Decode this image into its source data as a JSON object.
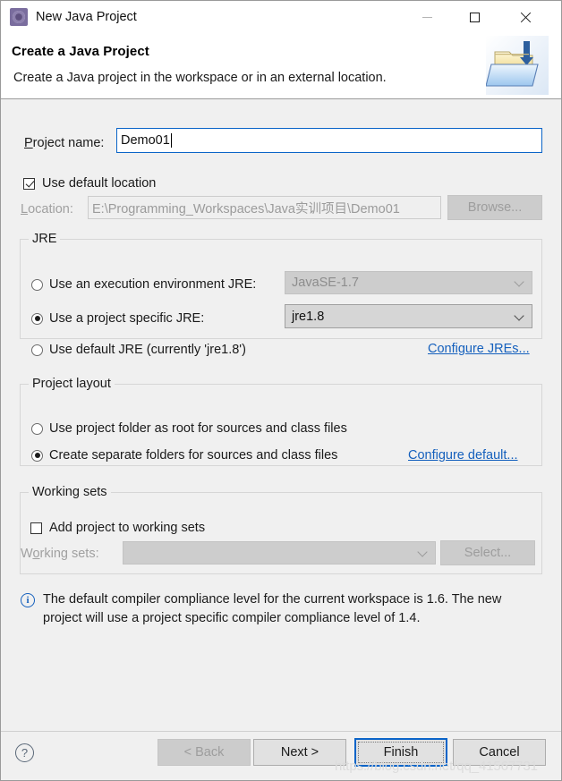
{
  "window": {
    "title": "New Java Project",
    "icon": "eclipse-java-icon",
    "minimize_label": "—",
    "maximize_label": "□",
    "close_label": "✕"
  },
  "header": {
    "title": "Create a Java Project",
    "description": "Create a Java project in the workspace or in an external location.",
    "banner_icon": "java-project-folder-icon"
  },
  "project_name": {
    "label": "Project name:",
    "value": "Demo01",
    "placeholder": ""
  },
  "location": {
    "use_default_label": "Use default location",
    "use_default_checked": true,
    "label": "Location:",
    "value": "E:\\Programming_Workspaces\\Java实训项目\\Demo01",
    "browse_label": "Browse...",
    "browse_enabled": false
  },
  "jre": {
    "group_title": "JRE",
    "options": [
      {
        "label": "Use an execution environment JRE:",
        "selected": false,
        "combo_value": "JavaSE-1.7",
        "combo_enabled": false
      },
      {
        "label": "Use a project specific JRE:",
        "selected": true,
        "combo_value": "jre1.8",
        "combo_enabled": true
      },
      {
        "label": "Use default JRE (currently 'jre1.8')",
        "selected": false
      }
    ],
    "configure_link": "Configure JREs..."
  },
  "project_layout": {
    "group_title": "Project layout",
    "options": [
      {
        "label": "Use project folder as root for sources and class files",
        "selected": false
      },
      {
        "label": "Create separate folders for sources and class files",
        "selected": true
      }
    ],
    "configure_link": "Configure default..."
  },
  "working_sets": {
    "group_title": "Working sets",
    "add_label": "Add project to working sets",
    "add_checked": false,
    "combo_label": "Working sets:",
    "combo_value": "",
    "combo_enabled": false,
    "select_label": "Select...",
    "select_enabled": false
  },
  "info": {
    "icon": "info-circle-icon",
    "message": "The default compiler compliance level for the current workspace is 1.6. The new project will use a project specific compiler compliance level of 1.4."
  },
  "footer": {
    "help_icon": "help-question-icon",
    "buttons": [
      {
        "label": "< Back",
        "enabled": false,
        "is_default": false
      },
      {
        "label": "Next >",
        "enabled": true,
        "is_default": false
      },
      {
        "label": "Finish",
        "enabled": true,
        "is_default": true
      },
      {
        "label": "Cancel",
        "enabled": true,
        "is_default": false
      }
    ]
  },
  "watermark": "https://blog.csdn.net/qq_41567731",
  "colors": {
    "accent": "#0a64c8",
    "link": "#1560bd",
    "dialog_bg": "#f0f0f0",
    "info": "#1560bd"
  }
}
